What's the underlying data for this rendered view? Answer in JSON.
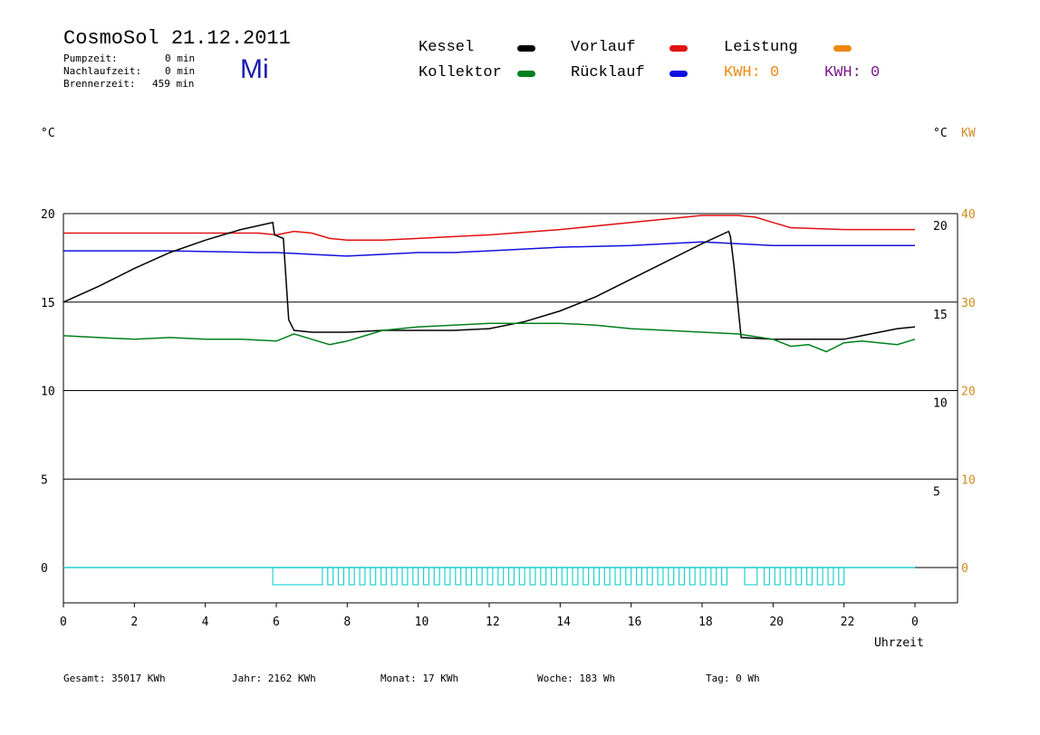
{
  "header": {
    "title": "CosmoSol 21.12.2011",
    "day": "Mi",
    "pumpzeit_label": "Pumpzeit:",
    "pumpzeit_value": "0 min",
    "nachlaufzeit_label": "Nachlaufzeit:",
    "nachlaufzeit_value": "0 min",
    "brennerzeit_label": "Brennerzeit:",
    "brennerzeit_value": "459 min"
  },
  "legend": {
    "kessel": "Kessel",
    "kollektor": "Kollektor",
    "vorlauf": "Vorlauf",
    "ruecklauf": "Rücklauf",
    "leistung": "Leistung",
    "kwh1": "KWH: 0",
    "kwh2": "KWH: 0"
  },
  "colors": {
    "kessel": "#000000",
    "kollektor": "#00801a",
    "vorlauf": "#e01010",
    "ruecklauf": "#1010e0",
    "leistung": "#ee8811",
    "kwh2": "#7a1a8a",
    "pump": "#22d0d0",
    "axis_right2": "#d08a20"
  },
  "units": {
    "left": "°C",
    "right1": "°C",
    "right2": "KW"
  },
  "footer": {
    "gesamt": "Gesamt:  35017 KWh",
    "jahr": "Jahr:  2162 KWh",
    "monat": "Monat:    17 KWh",
    "woche": "Woche:   183 Wh",
    "tag": "Tag:      0 Wh"
  },
  "chart_data": {
    "type": "line",
    "title": "CosmoSol 21.12.2011",
    "xlabel": "Uhrzeit",
    "ylabel": "°C",
    "xlim": [
      0,
      24
    ],
    "ylim": [
      -1.5,
      20.5
    ],
    "xticks": [
      0,
      4,
      8,
      12,
      16,
      20,
      24
    ],
    "xtick_labels": [
      "0",
      "2",
      "4",
      "6",
      "8",
      "10",
      "12",
      "14",
      "16",
      "18",
      "20",
      "22",
      "0"
    ],
    "xtick_values": [
      0,
      2,
      4,
      6,
      8,
      10,
      12,
      14,
      16,
      18,
      20,
      22,
      24
    ],
    "yticks_left": [
      0,
      5,
      10,
      15,
      20
    ],
    "yticks_right_temp": [
      5,
      10,
      15,
      20
    ],
    "yticks_right_kw": [
      0,
      10,
      20,
      30,
      40
    ],
    "grid": true,
    "series": [
      {
        "name": "Vorlauf",
        "color": "#e01010",
        "x": [
          0,
          3,
          5.5,
          6.0,
          6.5,
          7.0,
          7.5,
          8.0,
          9.0,
          10.0,
          11.0,
          12.0,
          14.0,
          16.0,
          17.0,
          18.0,
          19.0,
          19.5,
          20.0,
          20.5,
          22.0,
          23.0,
          24.0
        ],
        "y": [
          18.9,
          18.9,
          18.9,
          18.8,
          19.0,
          18.9,
          18.6,
          18.5,
          18.5,
          18.6,
          18.7,
          18.8,
          19.1,
          19.5,
          19.7,
          19.9,
          19.9,
          19.8,
          19.5,
          19.2,
          19.1,
          19.1,
          19.1
        ]
      },
      {
        "name": "Rücklauf",
        "color": "#1010e0",
        "x": [
          0,
          3,
          5.5,
          6.0,
          7.0,
          8.0,
          9.0,
          10.0,
          11.0,
          12.0,
          14.0,
          16.0,
          17.0,
          18.0,
          19.0,
          20.0,
          21.0,
          22.0,
          24.0
        ],
        "y": [
          17.9,
          17.9,
          17.8,
          17.8,
          17.7,
          17.6,
          17.7,
          17.8,
          17.8,
          17.9,
          18.1,
          18.2,
          18.3,
          18.4,
          18.3,
          18.2,
          18.2,
          18.2,
          18.2
        ]
      },
      {
        "name": "Kessel",
        "color": "#000000",
        "x": [
          0,
          1,
          2,
          3,
          4,
          5,
          5.9,
          5.95,
          6.2,
          6.25,
          6.35,
          6.5,
          7.0,
          8.0,
          9.0,
          10.0,
          11.0,
          12.0,
          13.0,
          14.0,
          15.0,
          16.0,
          17.0,
          18.0,
          18.75,
          18.8,
          18.9,
          19.1,
          20.0,
          21.0,
          22.0,
          22.5,
          23.0,
          23.5,
          24.0
        ],
        "y": [
          15.0,
          15.9,
          16.9,
          17.8,
          18.5,
          19.1,
          19.5,
          18.8,
          18.6,
          17.0,
          14.0,
          13.4,
          13.3,
          13.3,
          13.4,
          13.4,
          13.4,
          13.5,
          13.9,
          14.5,
          15.3,
          16.3,
          17.3,
          18.3,
          19.0,
          18.7,
          17.0,
          13.0,
          12.9,
          12.9,
          12.9,
          13.1,
          13.3,
          13.5,
          13.6
        ]
      },
      {
        "name": "Kollektor",
        "color": "#00801a",
        "x": [
          0,
          1,
          2,
          3,
          4,
          5,
          6,
          6.5,
          7.0,
          7.5,
          8.0,
          8.5,
          9.0,
          10.0,
          11.0,
          12.0,
          13.0,
          14.0,
          15.0,
          16.0,
          17.0,
          18.0,
          19.0,
          20.0,
          20.5,
          21.0,
          21.5,
          22.0,
          22.5,
          23.0,
          23.5,
          24.0
        ],
        "y": [
          13.1,
          13.0,
          12.9,
          13.0,
          12.9,
          12.9,
          12.8,
          13.2,
          12.9,
          12.6,
          12.8,
          13.1,
          13.4,
          13.6,
          13.7,
          13.8,
          13.8,
          13.8,
          13.7,
          13.5,
          13.4,
          13.3,
          13.2,
          12.9,
          12.5,
          12.6,
          12.2,
          12.7,
          12.8,
          12.7,
          12.6,
          12.9
        ]
      }
    ],
    "pump_segments": [
      [
        5.9,
        7.3
      ],
      [
        7.45,
        7.6
      ],
      [
        7.75,
        7.9
      ],
      [
        8.05,
        8.2
      ],
      [
        8.35,
        8.5
      ],
      [
        8.65,
        8.8
      ],
      [
        8.95,
        9.1
      ],
      [
        9.25,
        9.4
      ],
      [
        9.55,
        9.7
      ],
      [
        9.85,
        10.0
      ],
      [
        10.15,
        10.3
      ],
      [
        10.45,
        10.6
      ],
      [
        10.75,
        10.9
      ],
      [
        11.05,
        11.2
      ],
      [
        11.35,
        11.5
      ],
      [
        11.65,
        11.8
      ],
      [
        11.95,
        12.1
      ],
      [
        12.25,
        12.4
      ],
      [
        12.55,
        12.7
      ],
      [
        12.85,
        13.0
      ],
      [
        13.15,
        13.3
      ],
      [
        13.45,
        13.6
      ],
      [
        13.75,
        13.9
      ],
      [
        14.05,
        14.2
      ],
      [
        14.35,
        14.5
      ],
      [
        14.65,
        14.8
      ],
      [
        14.95,
        15.1
      ],
      [
        15.25,
        15.4
      ],
      [
        15.55,
        15.7
      ],
      [
        15.85,
        16.0
      ],
      [
        16.15,
        16.3
      ],
      [
        16.45,
        16.6
      ],
      [
        16.75,
        16.9
      ],
      [
        17.05,
        17.2
      ],
      [
        17.35,
        17.5
      ],
      [
        17.65,
        17.8
      ],
      [
        17.95,
        18.1
      ],
      [
        18.25,
        18.4
      ],
      [
        18.55,
        18.7
      ],
      [
        19.2,
        19.55
      ],
      [
        19.75,
        19.9
      ],
      [
        20.05,
        20.2
      ],
      [
        20.35,
        20.5
      ],
      [
        20.65,
        20.8
      ],
      [
        20.95,
        21.1
      ],
      [
        21.25,
        21.4
      ],
      [
        21.55,
        21.7
      ],
      [
        21.85,
        22.0
      ]
    ],
    "pump_height": -0.5
  }
}
